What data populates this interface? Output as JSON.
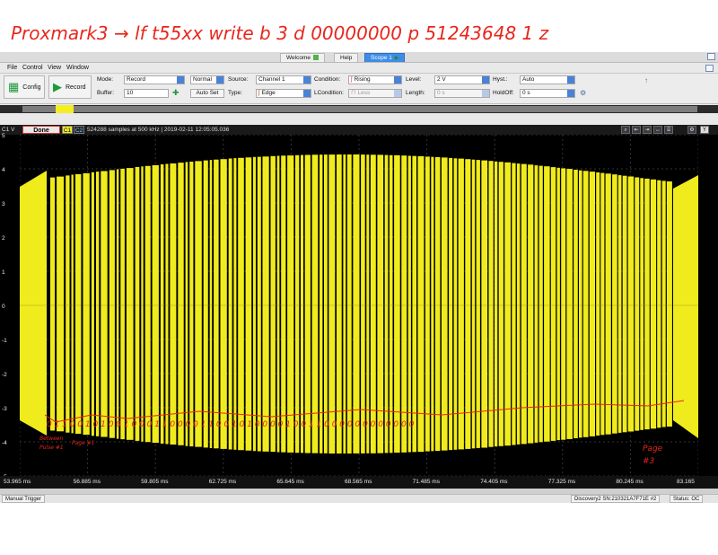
{
  "annotation_top": "Proxmark3 → lf t55xx write b 3 d 00000000 p 51243648 1 z",
  "tabs": [
    {
      "label": "Welcome",
      "active": false
    },
    {
      "label": "Help",
      "active": false
    },
    {
      "label": "Scope 1",
      "active": true
    }
  ],
  "menu": [
    "File",
    "Control",
    "View",
    "Window"
  ],
  "toolbar": {
    "config_label": "Config",
    "record_label": "Record",
    "mode_label": "Mode:",
    "mode_value": "Record",
    "normal_value": "Normal",
    "buffer_label": "Buffer:",
    "buffer_value": "10",
    "autoset_label": "Auto Set",
    "source_label": "Source:",
    "source_value": "Channel 1",
    "type_label": "Type:",
    "type_value": "Edge",
    "condition_label": "Condition:",
    "condition_value": "Rising",
    "lcondition_label": "LCondition:",
    "lcondition_value": "Less",
    "level_label": "Level:",
    "level_value": "2 V",
    "length_label": "Length:",
    "length_value": "0 s",
    "hyst_label": "Hyst.:",
    "hyst_value": "Auto",
    "holdoff_label": "HoldOff:",
    "holdoff_value": "0 s"
  },
  "plot": {
    "channel_label": "C1 V",
    "done_label": "Done",
    "c1_label": "C1",
    "c2_label": "C2",
    "info": "524288 samples at 500 kHz | 2019-02-11 12:05:05.036",
    "y_ticks": [
      "5",
      "4",
      "3",
      "2",
      "1",
      "0",
      "-1",
      "-2",
      "-3",
      "-4",
      "-5"
    ],
    "x_ticks": [
      "53.965 ms",
      "56.885 ms",
      "59.805 ms",
      "62.725 ms",
      "65.645 ms",
      "68.565 ms",
      "71.485 ms",
      "74.405 ms",
      "77.325 ms",
      "80.245 ms",
      "83.165"
    ],
    "signal_color": "#f0eb1d",
    "annotation_color": "#e8261c"
  },
  "annotations": {
    "bits_row": "0 1 1 0 0 1 0 1 0 0 1 0 0 0 1 1 0 0 0 0 1 1 0 0 1 0 1 0 0 0 0 1 0 0 1 1 0 0 0 0 0 0 0 0 0 0 0 0",
    "left_note_1": "Between",
    "left_note_2": "Pulse #1",
    "left_note_3": "Page #1",
    "right_note_1": "Page",
    "right_note_2": "#3"
  },
  "status": {
    "trigger": "Manual Trigger",
    "device": "Discovery2 SN:210321A7F71E #2",
    "state": "Status: OC"
  }
}
